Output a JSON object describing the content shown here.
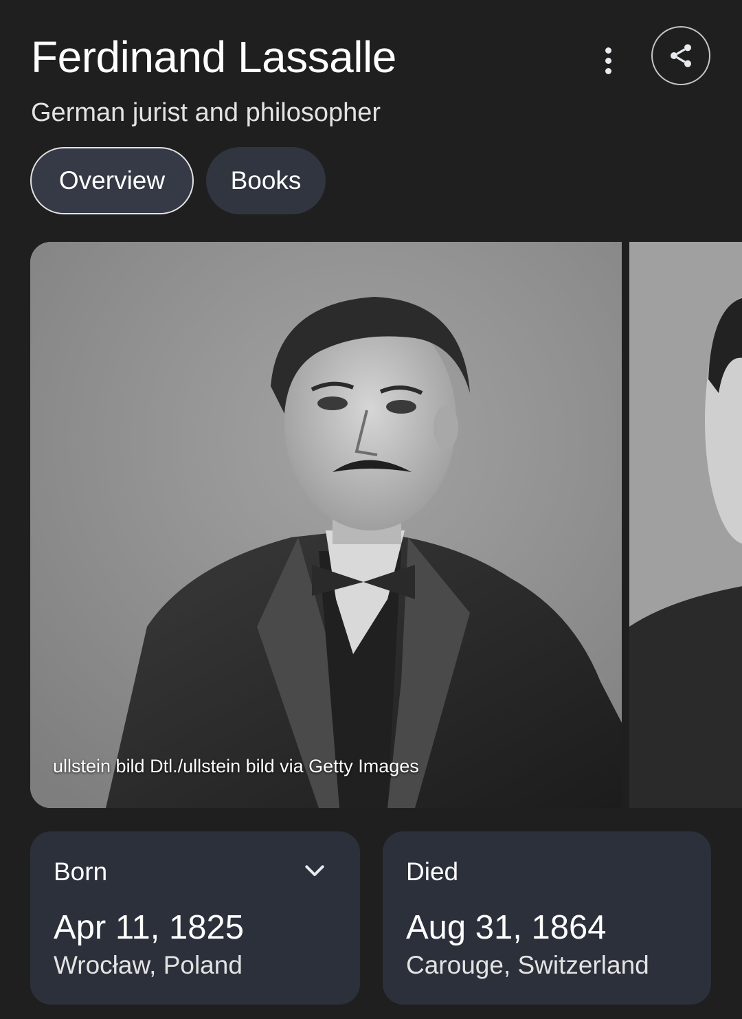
{
  "header": {
    "title": "Ferdinand Lassalle",
    "subtitle": "German jurist and philosopher",
    "more_icon": "more-vert-icon",
    "share_icon": "share-icon"
  },
  "tabs": [
    {
      "label": "Overview",
      "active": true
    },
    {
      "label": "Books",
      "active": false
    }
  ],
  "images": {
    "main_credit": "ullstein bild Dtl./ullstein bild via Getty Images"
  },
  "facts": {
    "born": {
      "label": "Born",
      "date": "Apr 11, 1825",
      "place": "Wrocław, Poland",
      "expand_icon": "chevron-down-icon"
    },
    "died": {
      "label": "Died",
      "date": "Aug 31, 1864",
      "place": "Carouge, Switzerland"
    }
  },
  "colors": {
    "background": "#1f1f1f",
    "card": "#2c303b",
    "tab": "#303540",
    "text": "#ffffff"
  }
}
